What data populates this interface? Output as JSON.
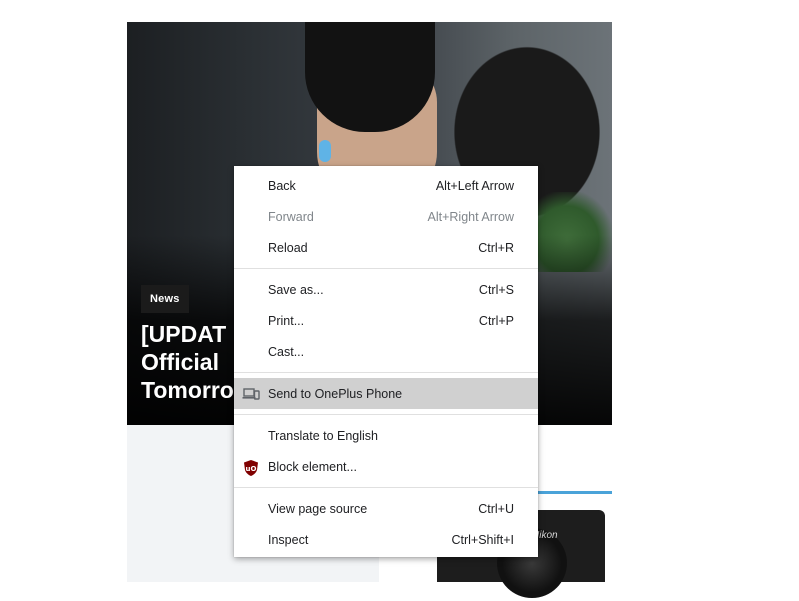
{
  "article": {
    "badge": "News",
    "headline_visible": "[UPDAT                                  Buds\nOfficial\nTomorro",
    "brand_on_camera": "Nikon"
  },
  "menu": {
    "items": [
      {
        "label": "Back",
        "shortcut": "Alt+Left Arrow",
        "disabled": false
      },
      {
        "label": "Forward",
        "shortcut": "Alt+Right Arrow",
        "disabled": true
      },
      {
        "label": "Reload",
        "shortcut": "Ctrl+R",
        "disabled": false
      },
      {
        "label": "Save as...",
        "shortcut": "Ctrl+S",
        "disabled": false
      },
      {
        "label": "Print...",
        "shortcut": "Ctrl+P",
        "disabled": false
      },
      {
        "label": "Cast...",
        "shortcut": "",
        "disabled": false
      },
      {
        "label": "Send to OnePlus Phone",
        "shortcut": "",
        "icon": "devices-icon",
        "highlighted": true
      },
      {
        "label": "Translate to English",
        "shortcut": "",
        "disabled": false
      },
      {
        "label": "Block element...",
        "shortcut": "",
        "icon": "ublock-origin-icon"
      },
      {
        "label": "View page source",
        "shortcut": "Ctrl+U",
        "disabled": false
      },
      {
        "label": "Inspect",
        "shortcut": "Ctrl+Shift+I",
        "disabled": false
      }
    ]
  },
  "colors": {
    "menu_highlight": "#d0d0d0",
    "ublock_red": "#800000",
    "accent_blue": "#4aa3d9"
  }
}
